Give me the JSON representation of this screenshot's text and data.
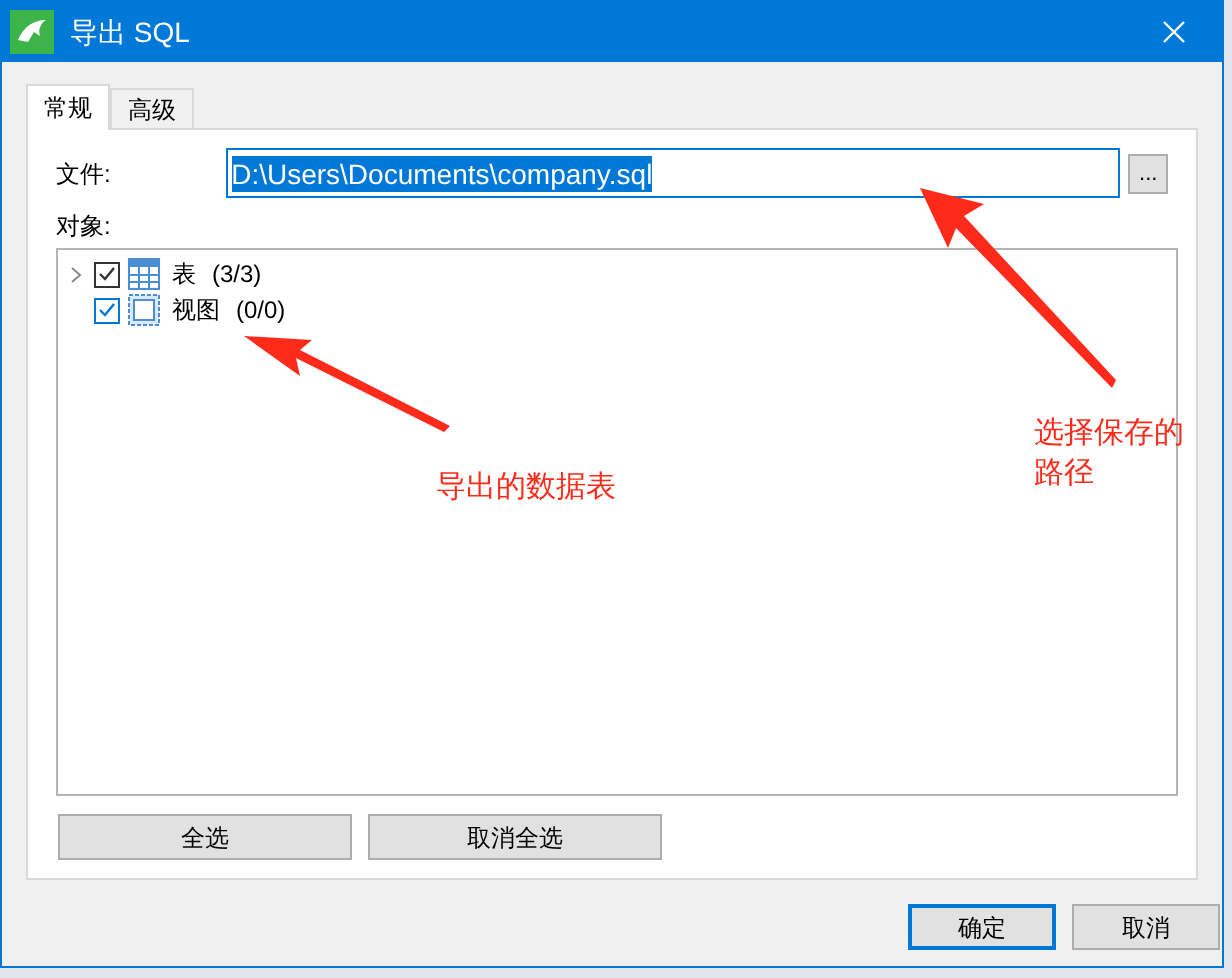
{
  "window": {
    "title": "导出 SQL"
  },
  "tabs": [
    {
      "label": "常规",
      "selected": true
    },
    {
      "label": "高级",
      "selected": false
    }
  ],
  "file": {
    "label": "文件:",
    "value": "D:\\Users\\Documents\\company.sql",
    "browse": "..."
  },
  "objects": {
    "label": "对象:",
    "items": [
      {
        "name": "表",
        "count": "(3/3)",
        "checked": true,
        "expandable": true,
        "kind": "table"
      },
      {
        "name": "视图",
        "count": "(0/0)",
        "checked": true,
        "expandable": false,
        "kind": "view"
      }
    ]
  },
  "select_buttons": [
    "全选",
    "取消全选"
  ],
  "dialog_buttons": [
    {
      "label": "确定",
      "default": true
    },
    {
      "label": "取消",
      "default": false
    }
  ],
  "annotations": [
    {
      "text": "导出的数据表"
    },
    {
      "text": "选择保存的路径"
    }
  ]
}
